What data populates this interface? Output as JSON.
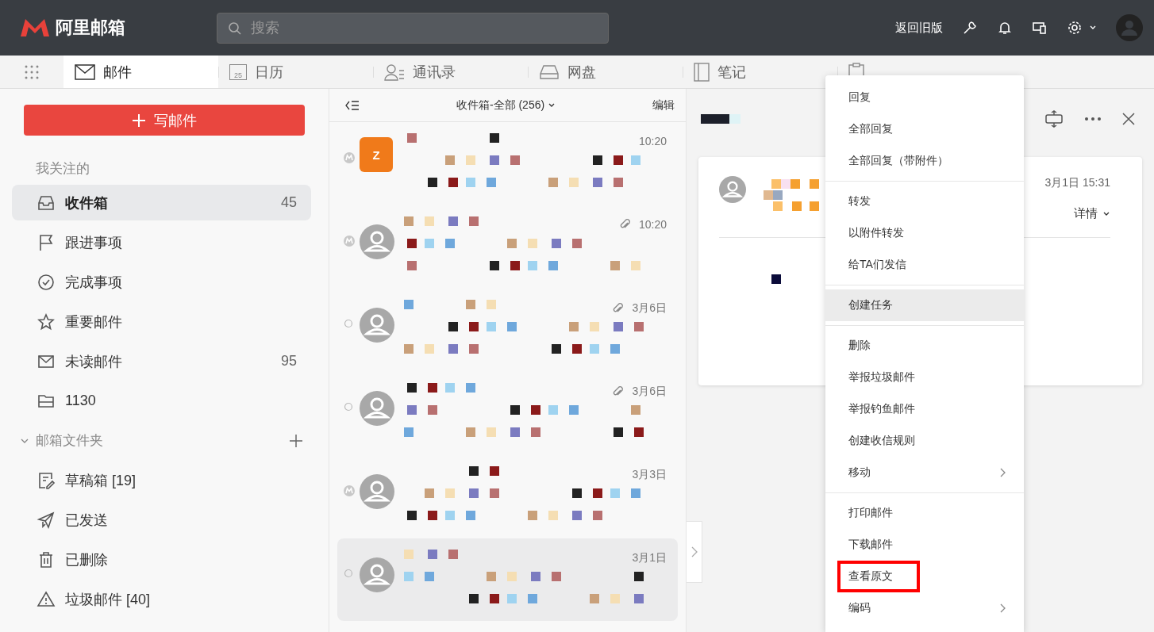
{
  "header": {
    "brand": "阿里邮箱",
    "search": {
      "placeholder": "搜索"
    },
    "old_version": "返回旧版"
  },
  "tabs": [
    {
      "label": "邮件",
      "selected": true
    },
    {
      "label": "日历",
      "selected": false,
      "date": "25"
    },
    {
      "label": "通讯录",
      "selected": false
    },
    {
      "label": "网盘",
      "selected": false
    },
    {
      "label": "笔记",
      "selected": false
    },
    {
      "selected": false
    }
  ],
  "sidebar": {
    "compose": "写邮件",
    "favorites_title": "我关注的",
    "favorites": [
      {
        "label": "收件箱",
        "count": "45",
        "selected": true
      },
      {
        "label": "跟进事项",
        "selected": false
      },
      {
        "label": "完成事项",
        "selected": false
      },
      {
        "label": "重要邮件",
        "selected": false
      },
      {
        "label": "未读邮件",
        "count": "95",
        "selected": false
      },
      {
        "label": "1130",
        "selected": false
      }
    ],
    "folders_title": "邮箱文件夹",
    "folders_expanded": true,
    "folders": [
      {
        "label": "草稿箱 [19]",
        "selected": false
      },
      {
        "label": "已发送",
        "selected": false
      },
      {
        "label": "已删除",
        "selected": false
      },
      {
        "label": "垃圾邮件 [40]",
        "selected": false
      }
    ]
  },
  "mail_list": {
    "title": "收件箱-全部 (256)",
    "edit": "编辑",
    "items": [
      {
        "kind": "badge",
        "avatar": "Z",
        "time": "10:20",
        "attachment": false,
        "selected": false
      },
      {
        "kind": "badge",
        "time": "10:20",
        "attachment": true,
        "selected": false
      },
      {
        "kind": "dot",
        "time": "3月6日",
        "attachment": true,
        "selected": false
      },
      {
        "kind": "dot",
        "time": "3月6日",
        "attachment": true,
        "selected": false
      },
      {
        "kind": "badge",
        "time": "3月3日",
        "attachment": false,
        "selected": false
      },
      {
        "kind": "dot",
        "time": "3月1日",
        "attachment": false,
        "selected": true
      }
    ]
  },
  "reader": {
    "date": "3月1日 15:31",
    "details": "详情"
  },
  "context_menu": {
    "groups": [
      [
        {
          "label": "回复",
          "selected": false,
          "submenu": false,
          "annotated": false
        },
        {
          "label": "全部回复",
          "selected": false,
          "submenu": false,
          "annotated": false
        },
        {
          "label": "全部回复（带附件）",
          "selected": false,
          "submenu": false,
          "annotated": false
        }
      ],
      [
        {
          "label": "转发",
          "selected": false,
          "submenu": false,
          "annotated": false
        },
        {
          "label": "以附件转发",
          "selected": false,
          "submenu": false,
          "annotated": false
        },
        {
          "label": "给TA们发信",
          "selected": false,
          "submenu": false,
          "annotated": false
        }
      ],
      [
        {
          "label": "创建任务",
          "selected": true,
          "submenu": false,
          "annotated": false
        }
      ],
      [
        {
          "label": "删除",
          "selected": false,
          "submenu": false,
          "annotated": false
        },
        {
          "label": "举报垃圾邮件",
          "selected": false,
          "submenu": false,
          "annotated": false
        },
        {
          "label": "举报钓鱼邮件",
          "selected": false,
          "submenu": false,
          "annotated": false
        },
        {
          "label": "创建收信规则",
          "selected": false,
          "submenu": false,
          "annotated": false
        },
        {
          "label": "移动",
          "selected": false,
          "submenu": true,
          "annotated": false
        }
      ],
      [
        {
          "label": "打印邮件",
          "selected": false,
          "submenu": false,
          "annotated": false
        },
        {
          "label": "下载邮件",
          "selected": false,
          "submenu": false,
          "annotated": false
        },
        {
          "label": "查看原文",
          "selected": false,
          "submenu": false,
          "annotated": true
        },
        {
          "label": "编码",
          "selected": false,
          "submenu": true,
          "annotated": false
        }
      ]
    ]
  }
}
